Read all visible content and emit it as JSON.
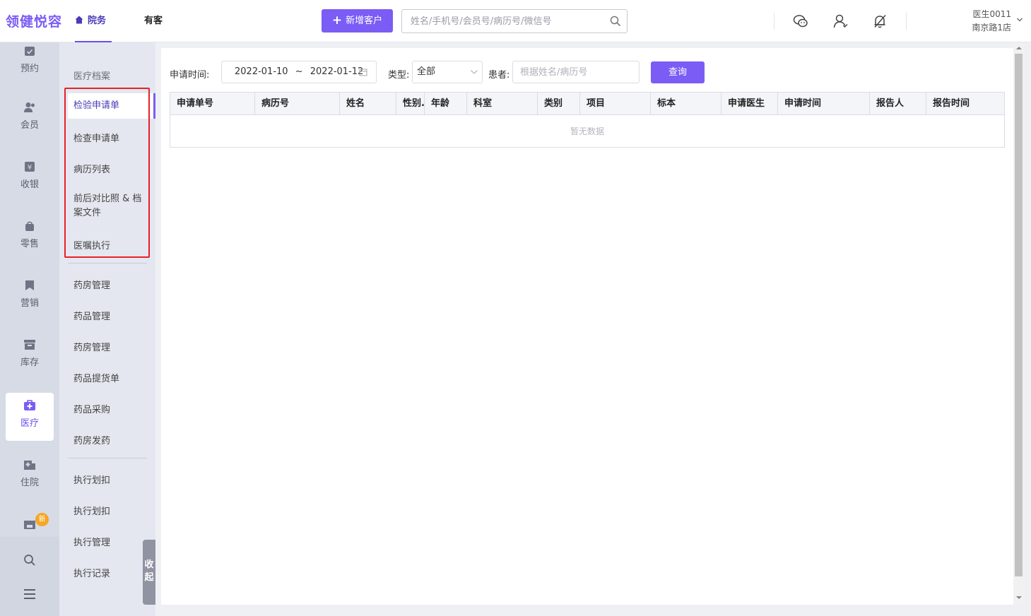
{
  "app": {
    "logo": "领健悦容"
  },
  "header": {
    "tabs": [
      {
        "label": "院务",
        "active": true
      },
      {
        "label": "有客",
        "active": false
      }
    ],
    "add_customer_label": "新增客户",
    "search_placeholder": "姓名/手机号/会员号/病历号/微信号",
    "icons": [
      "wechat-icon",
      "user-icon",
      "bell-off-icon"
    ],
    "user": {
      "name": "医生0011",
      "store": "南京路1店"
    }
  },
  "rail": {
    "items": [
      {
        "label": "预约",
        "icon": "calendar-icon"
      },
      {
        "label": "会员",
        "icon": "members-icon"
      },
      {
        "label": "收银",
        "icon": "cashier-icon"
      },
      {
        "label": "零售",
        "icon": "bag-icon"
      },
      {
        "label": "营销",
        "icon": "bookmark-icon"
      },
      {
        "label": "库存",
        "icon": "inventory-icon"
      },
      {
        "label": "医疗",
        "icon": "medical-kit-icon",
        "active": true
      },
      {
        "label": "住院",
        "icon": "hospital-icon"
      }
    ],
    "new_badge": "新"
  },
  "submenu": {
    "section1_title": "医疗档案",
    "section1_items": [
      "检验申请单",
      "检查申请单",
      "病历列表",
      "前后对比照 & 档案文件",
      "医嘱执行"
    ],
    "section2_items": [
      "药房管理",
      "药品管理",
      "药房管理",
      "药品提货单",
      "药品采购",
      "药房发药"
    ],
    "section3_items": [
      "执行划扣",
      "执行划扣",
      "执行管理",
      "执行记录"
    ],
    "collapse_label": "收起",
    "active_item": "检验申请单"
  },
  "filters": {
    "apply_time_label": "申请时间:",
    "date_start": "2022-01-10",
    "date_sep": "~",
    "date_end": "2022-01-12",
    "type_label": "类型:",
    "type_value": "全部",
    "patient_label": "患者:",
    "patient_placeholder": "根据姓名/病历号",
    "query_label": "查询"
  },
  "table": {
    "columns": [
      "申请单号",
      "病历号",
      "姓名",
      "性别.",
      "年龄",
      "科室",
      "类别",
      "项目",
      "标本",
      "申请医生",
      "申请时间",
      "报告人",
      "报告时间"
    ],
    "empty_text": "暂无数据"
  },
  "colors": {
    "accent": "#7b5cf5",
    "highlight_frame": "#e8202a"
  }
}
